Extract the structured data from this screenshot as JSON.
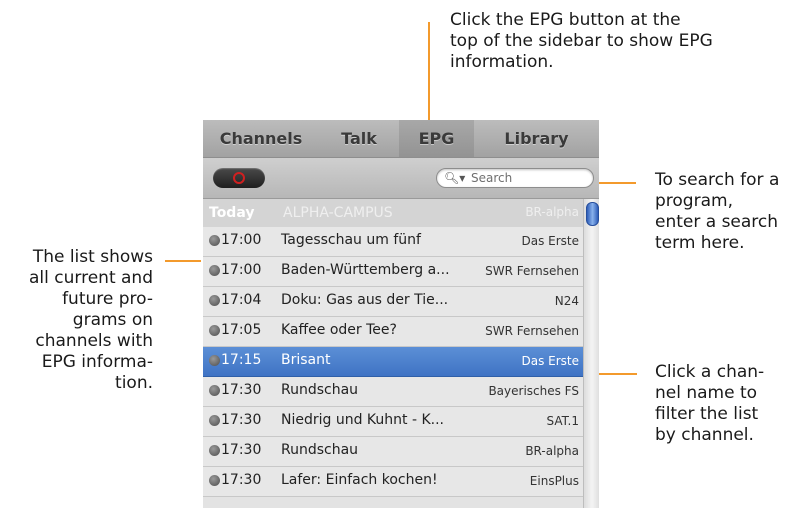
{
  "callouts": {
    "epg_button": [
      "Click the EPG button at the",
      "top of the sidebar to show EPG",
      "information."
    ],
    "search": [
      "To search for a",
      "program,",
      "enter a search",
      "term here."
    ],
    "list": [
      "The list shows",
      "all current and",
      "future pro-",
      "grams on",
      "channels with",
      "EPG informa-",
      "tion."
    ],
    "channel": [
      "Click a chan-",
      "nel name to",
      "filter the list",
      "by channel."
    ]
  },
  "tabs": [
    "Channels",
    "Talk",
    "EPG",
    "Library"
  ],
  "active_tab": "EPG",
  "search": {
    "placeholder": "Search"
  },
  "list": {
    "today_label": "Today",
    "today_program": "ALPHA-CAMPUS",
    "today_channel": "BR-alpha",
    "rows": [
      {
        "time": "17:00",
        "title": "Tagesschau um fünf",
        "channel": "Das Erste"
      },
      {
        "time": "17:00",
        "title": "Baden-Württemberg a...",
        "channel": "SWR Fernsehen"
      },
      {
        "time": "17:04",
        "title": "Doku: Gas aus der Tie...",
        "channel": "N24"
      },
      {
        "time": "17:05",
        "title": "Kaffee oder Tee?",
        "channel": "SWR Fernsehen"
      },
      {
        "time": "17:15",
        "title": "Brisant",
        "channel": "Das Erste",
        "selected": true
      },
      {
        "time": "17:30",
        "title": "Rundschau",
        "channel": "Bayerisches FS"
      },
      {
        "time": "17:30",
        "title": "Niedrig und Kuhnt - K...",
        "channel": "SAT.1"
      },
      {
        "time": "17:30",
        "title": "Rundschau",
        "channel": "BR-alpha"
      },
      {
        "time": "17:30",
        "title": "Lafer: Einfach kochen!",
        "channel": "EinsPlus"
      }
    ]
  },
  "colors": {
    "callout_line": "#f39a2c",
    "selection": "#3f73c4"
  }
}
